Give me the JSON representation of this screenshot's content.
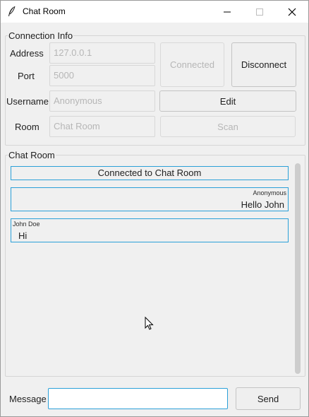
{
  "window": {
    "title": "Chat Room"
  },
  "connection": {
    "group_label": "Connection Info",
    "address_label": "Address",
    "address_value": "127.0.0.1",
    "port_label": "Port",
    "port_value": "5000",
    "username_label": "Username",
    "username_value": "Anonymous",
    "room_label": "Room",
    "room_value": "Chat Room",
    "connected_button": "Connected",
    "disconnect_button": "Disconnect",
    "edit_button": "Edit",
    "scan_button": "Scan"
  },
  "chat": {
    "group_label": "Chat Room",
    "messages": [
      {
        "type": "system",
        "text": "Connected to Chat Room"
      },
      {
        "type": "outgoing",
        "sender": "Anonymous",
        "text": "Hello John"
      },
      {
        "type": "incoming",
        "sender": "John Doe",
        "text": "Hi"
      }
    ]
  },
  "composer": {
    "label": "Message",
    "value": "",
    "send_button": "Send"
  },
  "colors": {
    "accent": "#2ba0d8",
    "disabled_text": "#b6b6b6",
    "background": "#f0f0f0"
  }
}
